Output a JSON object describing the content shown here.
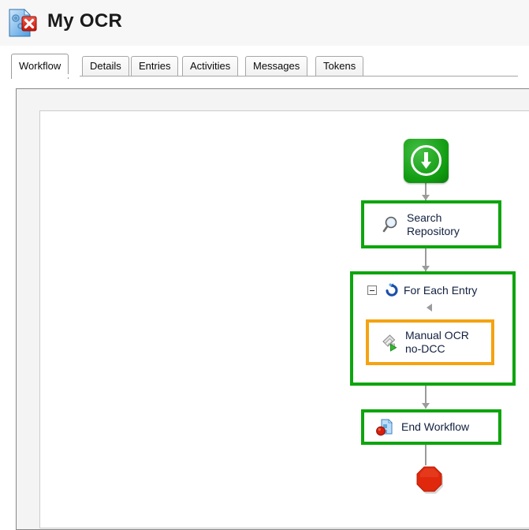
{
  "header": {
    "title": "My OCR",
    "icon": "document-gears-error-icon"
  },
  "tabs": [
    {
      "label": "Workflow",
      "name": "tab-workflow",
      "active": true
    },
    {
      "label": "Details",
      "name": "tab-details",
      "active": false
    },
    {
      "label": "Entries",
      "name": "tab-entries",
      "active": false
    },
    {
      "label": "Activities",
      "name": "tab-activities",
      "active": false
    },
    {
      "label": "Messages",
      "name": "tab-messages",
      "active": false
    },
    {
      "label": "Tokens",
      "name": "tab-tokens",
      "active": false
    }
  ],
  "workflow": {
    "start": {
      "icon": "start-down-arrow-icon",
      "label": ""
    },
    "nodes": [
      {
        "id": "search",
        "label": "Search\nRepository",
        "icon": "magnifier-icon",
        "border": "#0ea50e"
      },
      {
        "id": "foreach",
        "label": "For Each Entry",
        "icon": "loop-refresh-icon",
        "border": "#0ea50e",
        "collapsed": false
      },
      {
        "id": "manual",
        "label": "Manual OCR\nno-DCC",
        "icon": "manual-activity-icon",
        "border": "#f5a312"
      },
      {
        "id": "end",
        "label": "End Workflow",
        "icon": "end-document-icon",
        "border": "#0ea50e"
      }
    ],
    "stop": {
      "icon": "stop-octagon-icon"
    }
  },
  "colors": {
    "accent_green": "#0ea50e",
    "accent_orange": "#f5a312",
    "stop_red": "#e02b0c",
    "connector_grey": "#9b9b9b",
    "header_bg": "#f7f7f7",
    "panel_bg": "#f4f4f4"
  }
}
